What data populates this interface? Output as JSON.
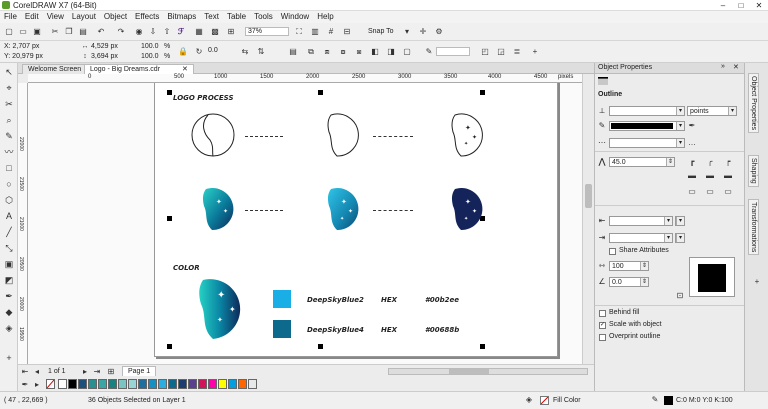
{
  "window": {
    "title": "CorelDRAW X7 (64-Bit)",
    "min": "–",
    "max": "□",
    "close": "✕"
  },
  "menu": [
    "File",
    "Edit",
    "View",
    "Layout",
    "Object",
    "Effects",
    "Bitmaps",
    "Text",
    "Table",
    "Tools",
    "Window",
    "Help"
  ],
  "toolbar": {
    "zoom": "37%",
    "snap_to": "Snap To"
  },
  "property_bar": {
    "x": "X: 2,707 px",
    "y": "Y: 20,979 px",
    "width": "4,529 px",
    "height": "3,694 px",
    "scale_w": "100.0",
    "scale_h": "100.0",
    "pct": "%",
    "angle": "0.0"
  },
  "tabs": {
    "welcome": "Welcome Screen",
    "doc": "Logo - Big Dreams.cdr"
  },
  "ruler_h": [
    "0",
    "500",
    "1000",
    "1500",
    "2000",
    "2500",
    "3000",
    "3500",
    "4000",
    "4500",
    "5000",
    "5500"
  ],
  "ruler_unit": "pixels",
  "ruler_v": [
    "22000",
    "21500",
    "21000",
    "20500",
    "20000",
    "19500"
  ],
  "canvas": {
    "heading1": "LOGO PROCESS",
    "heading2": "COLOR",
    "swatch1_label": "DeepSkyBlue2",
    "swatch1_hex_label": "HEX",
    "swatch1_hex": "#00b2ee",
    "swatch2_label": "DeepSkyBlue4",
    "swatch2_hex_label": "HEX",
    "swatch2_hex": "#00688b",
    "swatch1_color": "#1aaee6",
    "swatch2_color": "#0d6a8c"
  },
  "page_nav": {
    "page_count": "1 of 1",
    "page_tab": "Page 1"
  },
  "palette": [
    "#ffffff",
    "#000000",
    "#1e4f7a",
    "#2a8f8f",
    "#3aa6a6",
    "#1a8080",
    "#7ac4c4",
    "#9ad4d4",
    "#1e6f9f",
    "#1590c0",
    "#2aaee0",
    "#0d6a8c",
    "#1a3f6e",
    "#5a3f8f",
    "#d4145a",
    "#ff00aa",
    "#ffff00",
    "#00a0e0",
    "#ff6600",
    "#e8e8e8"
  ],
  "status": {
    "coords": "( 47 , 22,669 )",
    "selection": "36 Objects Selected on Layer 1",
    "fill": "Fill Color",
    "outline": "C:0 M:0 Y:0 K:100"
  },
  "docker": {
    "title": "Object Properties",
    "section": "Outline",
    "units": "points",
    "miter": "45.0",
    "share_attrs": "Share Attributes",
    "stretch": "100",
    "angle": "0.0",
    "behind_fill": "Behind fill",
    "scale_with_object": "Scale with object",
    "overprint": "Overprint outline",
    "outline_color": "#000000"
  },
  "docker_tabs": [
    "Object Properties",
    "Shaping",
    "Transformations"
  ]
}
